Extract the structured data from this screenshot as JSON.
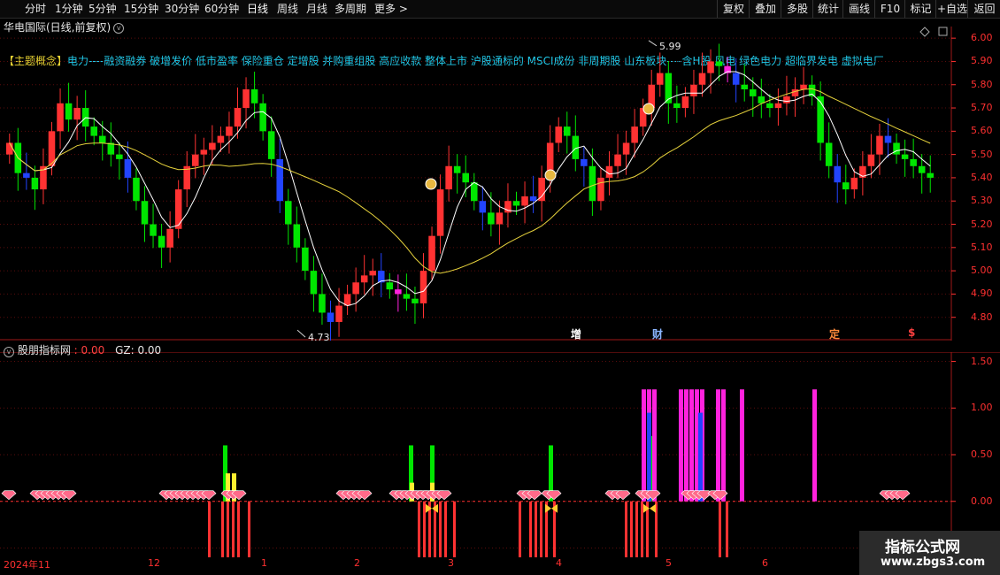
{
  "toolbar": {
    "left": [
      "分时",
      "1分钟",
      "5分钟",
      "15分钟",
      "30分钟",
      "60分钟",
      "日线",
      "周线",
      "月线",
      "多周期",
      "更多 >"
    ],
    "right": [
      "复权",
      "叠加",
      "多股",
      "统计",
      "画线",
      "F10",
      "标记",
      "+自选",
      "返回"
    ]
  },
  "chart_title": "华电国际(日线,前复权)",
  "concept": {
    "prefix": "【主题概念】",
    "text": "电力----融资融券 破增发价 低市盈率 保险重仓 定增股 并购重组股 高应收款 整体上市 沪股通标的 MSCI成份 非周期股 山东板块----含H股 风电 绿色电力 超临界发电 虚拟电厂"
  },
  "price_axis": [
    "6.00",
    "5.90",
    "5.80",
    "5.70",
    "5.60",
    "5.50",
    "5.40",
    "5.30",
    "5.20",
    "5.10",
    "5.00",
    "4.90",
    "4.80"
  ],
  "high_label": "5.99",
  "low_label": "4.73",
  "event_markers": [
    {
      "text": "增",
      "color": "#ffffff"
    },
    {
      "text": "财",
      "color": "#8ab4ff"
    },
    {
      "text": "定",
      "color": "#ff8a3a"
    },
    {
      "text": "$",
      "color": "#ff4040"
    }
  ],
  "indicator": {
    "name": "股朋指标网",
    "value1": ": 0.00",
    "value2": "GZ: 0.00",
    "axis": [
      "1.50",
      "1.00",
      "0.50",
      "0.00",
      "-0.50"
    ]
  },
  "dates": [
    "2024年11",
    "12",
    "1",
    "2",
    "3",
    "4",
    "5",
    "6"
  ],
  "watermark": {
    "line1": "指标公式网",
    "line2": "www.zbgs3.com"
  },
  "colors": {
    "up": "#ff3232",
    "down": "#00e600",
    "blue": "#2244ff",
    "magenta": "#ff22dd",
    "ma_short": "#ffffff",
    "ma_long": "#e6d23c",
    "pink": "#ff6a8a"
  },
  "chart_data": [
    {
      "type": "candlestick",
      "ylim": [
        4.7,
        6.05
      ],
      "high_label": 5.99,
      "low_label": 4.73,
      "close": [
        5.55,
        5.42,
        5.4,
        5.35,
        5.45,
        5.6,
        5.72,
        5.65,
        5.7,
        5.62,
        5.58,
        5.55,
        5.5,
        5.48,
        5.4,
        5.3,
        5.2,
        5.15,
        5.1,
        5.18,
        5.35,
        5.45,
        5.5,
        5.52,
        5.55,
        5.58,
        5.62,
        5.7,
        5.78,
        5.72,
        5.6,
        5.48,
        5.3,
        5.2,
        5.1,
        5.0,
        4.9,
        4.82,
        4.78,
        4.85,
        4.9,
        4.95,
        4.98,
        5.0,
        4.95,
        4.92,
        4.9,
        4.88,
        4.86,
        5.0,
        5.15,
        5.35,
        5.45,
        5.42,
        5.38,
        5.3,
        5.25,
        5.2,
        5.25,
        5.3,
        5.28,
        5.32,
        5.3,
        5.4,
        5.55,
        5.62,
        5.58,
        5.48,
        5.45,
        5.3,
        5.4,
        5.45,
        5.5,
        5.55,
        5.62,
        5.7,
        5.8,
        5.85,
        5.72,
        5.7,
        5.75,
        5.8,
        5.85,
        5.9,
        5.88,
        5.85,
        5.8,
        5.78,
        5.75,
        5.72,
        5.7,
        5.72,
        5.75,
        5.78,
        5.8,
        5.75,
        5.55,
        5.45,
        5.38,
        5.35,
        5.4,
        5.45,
        5.5,
        5.58,
        5.55,
        5.5,
        5.48,
        5.45,
        5.42,
        5.4
      ]
    },
    {
      "type": "bar",
      "ylim": [
        -0.6,
        1.6
      ],
      "note_values": "indicator histogram, positive bars 0-1.2, negative bars to -0.8"
    }
  ]
}
